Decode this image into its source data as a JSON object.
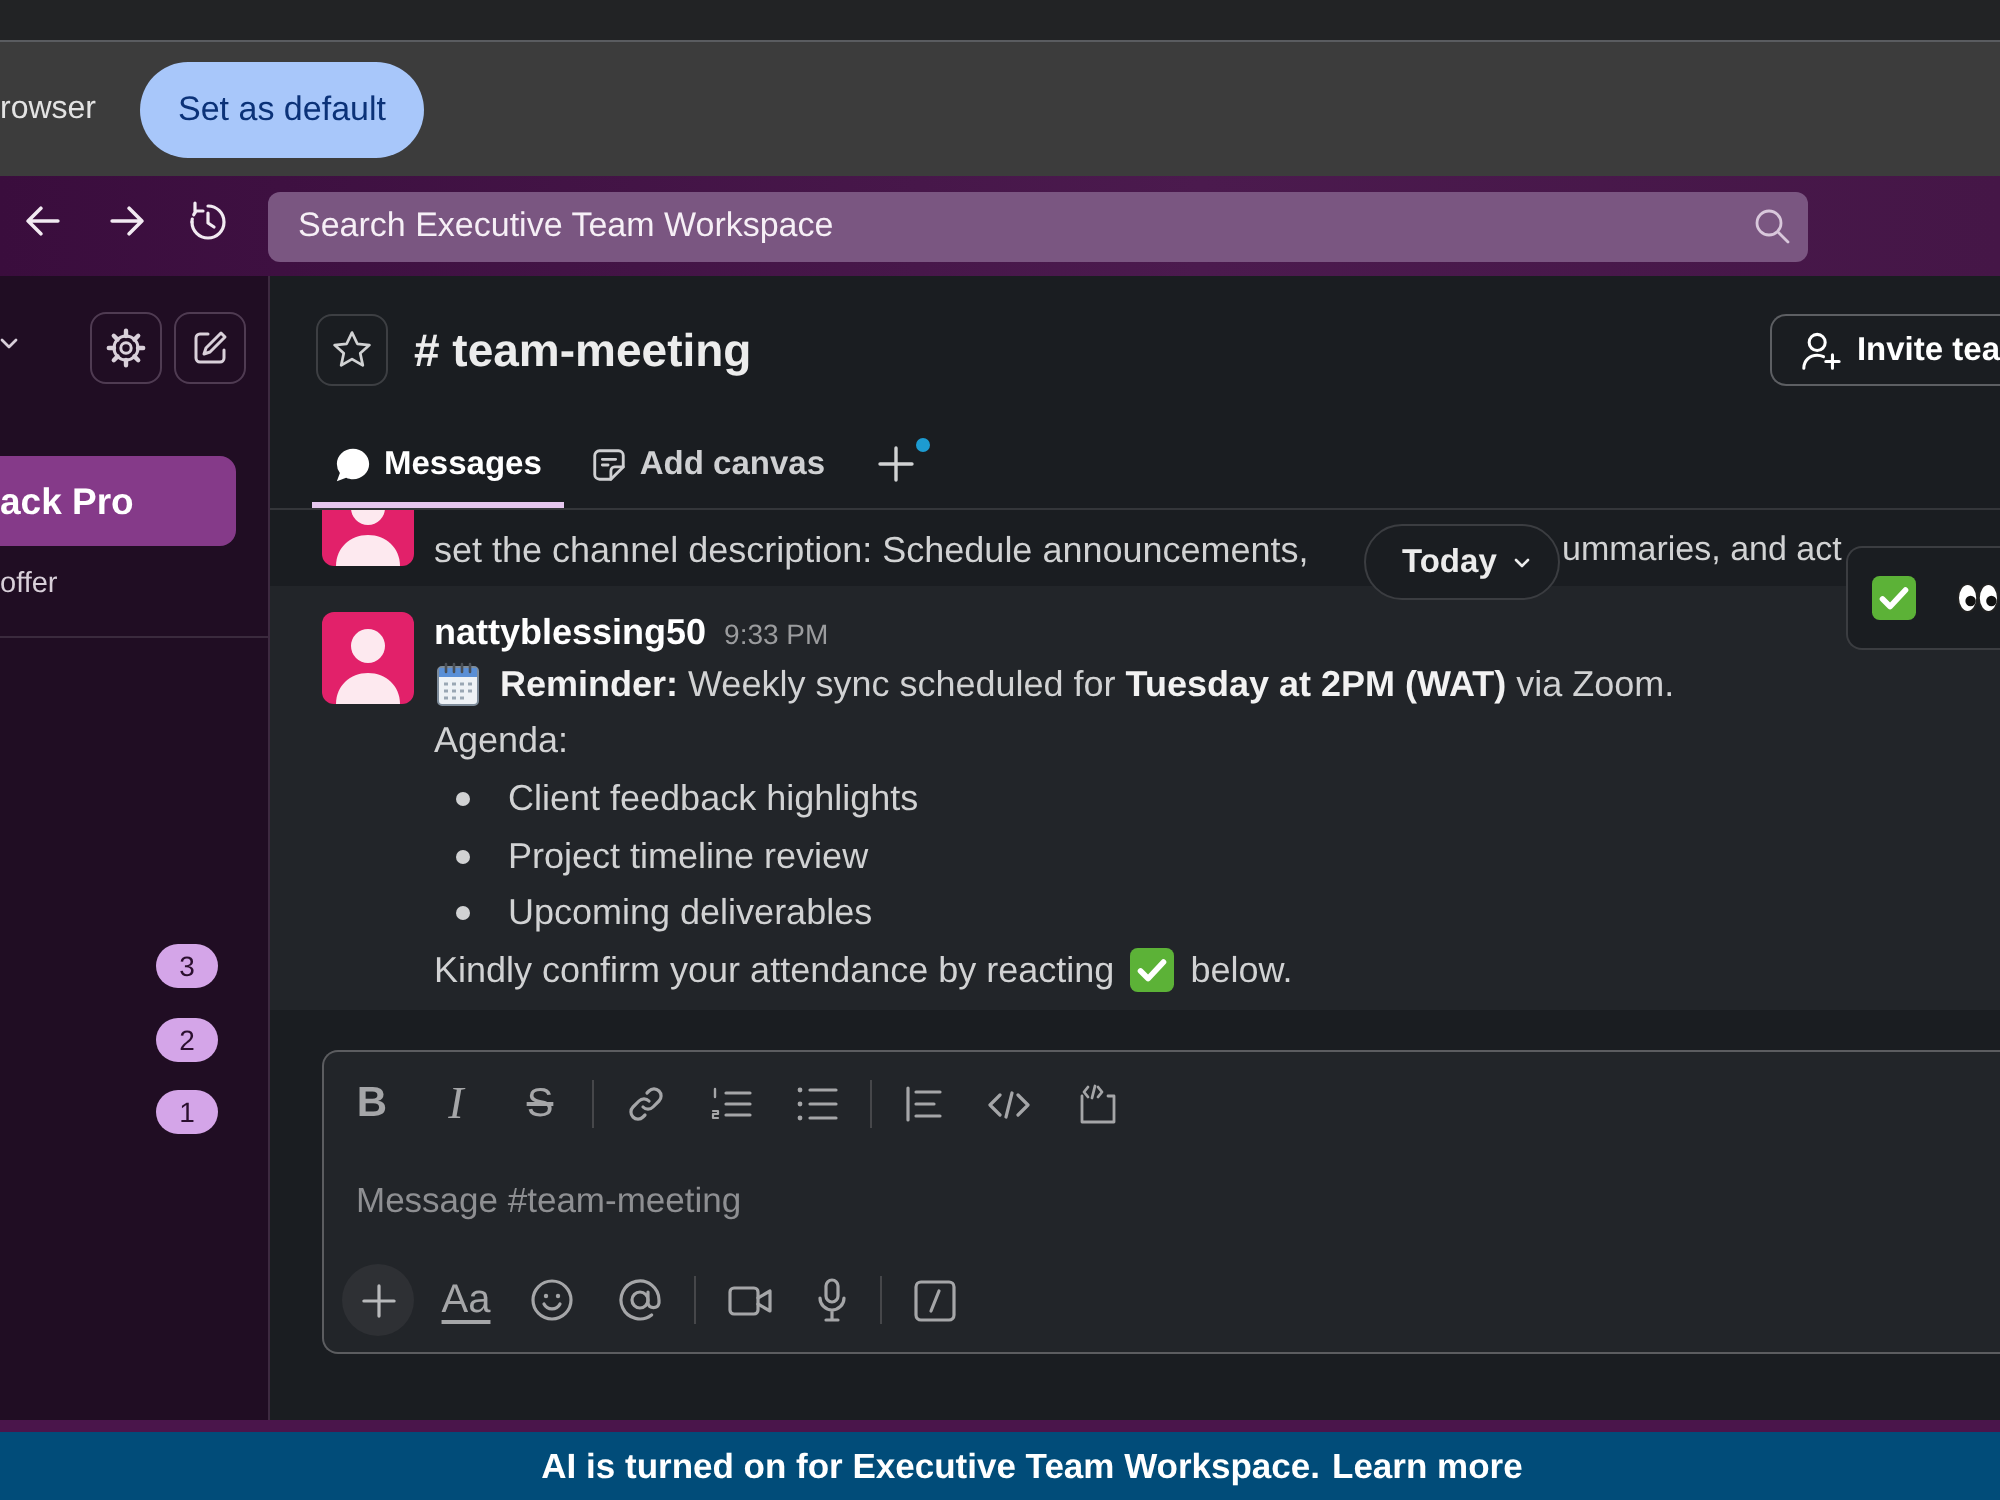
{
  "browser_infobar": {
    "message": "rowser",
    "button": "Set as default"
  },
  "top_bar": {
    "search": {
      "placeholder": "Search Executive Team Workspace"
    }
  },
  "sidebar": {
    "upgrade_button": "ack Pro",
    "offer": "offer",
    "badges": [
      "3",
      "2",
      "1"
    ]
  },
  "channel": {
    "name": "# team-meeting",
    "invite_button": "Invite tea",
    "tabs": [
      {
        "kind": "messages",
        "label": "Messages",
        "selected": true
      },
      {
        "kind": "canvas",
        "label": "Add canvas",
        "selected": false
      }
    ],
    "add_tab": {
      "unread_dot": true
    }
  },
  "messages": [
    {
      "hovered": false,
      "blocks": [
        {
          "kind": "split_text",
          "parts": [
            "set the channel description: Schedule announcements,",
            "ummaries, and act"
          ]
        }
      ]
    },
    {
      "hovered": true,
      "author": "nattyblessing50",
      "time": "9:33 PM",
      "blocks": [
        {
          "kind": "event",
          "text": "**Reminder:** Weekly sync scheduled for **Tuesday at 2PM (WAT)** via Zoom."
        },
        {
          "kind": "text",
          "text": "Agenda:"
        },
        {
          "kind": "list",
          "items": [
            "Client feedback highlights",
            "Project timeline review",
            "Upcoming deliverables"
          ]
        },
        {
          "kind": "reaction_prompt",
          "before": "Kindly confirm your attendance by reacting",
          "after": "below."
        }
      ]
    }
  ],
  "date_divider": {
    "label": "Today"
  },
  "composer": {
    "placeholder": "Message #team-meeting",
    "format_toolbar": [
      {
        "kind": "bold",
        "label": "B"
      },
      {
        "kind": "italic",
        "label": "I"
      },
      {
        "kind": "strike",
        "label": "S"
      },
      {
        "kind": "separator"
      },
      {
        "kind": "link"
      },
      {
        "kind": "ordered_list"
      },
      {
        "kind": "bullet_list"
      },
      {
        "kind": "separator"
      },
      {
        "kind": "quote"
      },
      {
        "kind": "code"
      },
      {
        "kind": "code_block"
      }
    ],
    "action_toolbar": [
      {
        "kind": "attach"
      },
      {
        "kind": "format",
        "label": "Aa"
      },
      {
        "kind": "emoji"
      },
      {
        "kind": "mention"
      },
      {
        "kind": "separator"
      },
      {
        "kind": "video"
      },
      {
        "kind": "audio"
      },
      {
        "kind": "separator"
      },
      {
        "kind": "shortcuts"
      }
    ]
  },
  "banner": {
    "text": "AI is turned on for Executive Team Workspace.",
    "link": "Learn more"
  }
}
